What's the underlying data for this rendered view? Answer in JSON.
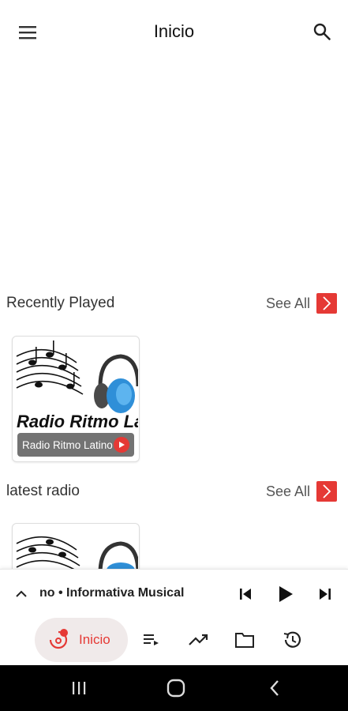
{
  "appbar": {
    "title": "Inicio",
    "menu_icon": "menu-icon",
    "search_icon": "search-icon"
  },
  "sections": [
    {
      "label": "Recently Played",
      "see_all": "See All"
    },
    {
      "label": "latest radio",
      "see_all": "See All"
    }
  ],
  "recent_card": {
    "name": "Radio Ritmo Latino",
    "art_text": "Radio Ritmo Latino"
  },
  "mini_player": {
    "now_playing": "no • Informativa Musical"
  },
  "bottom_nav": {
    "home_label": "Inicio"
  },
  "colors": {
    "accent": "#e53935"
  }
}
